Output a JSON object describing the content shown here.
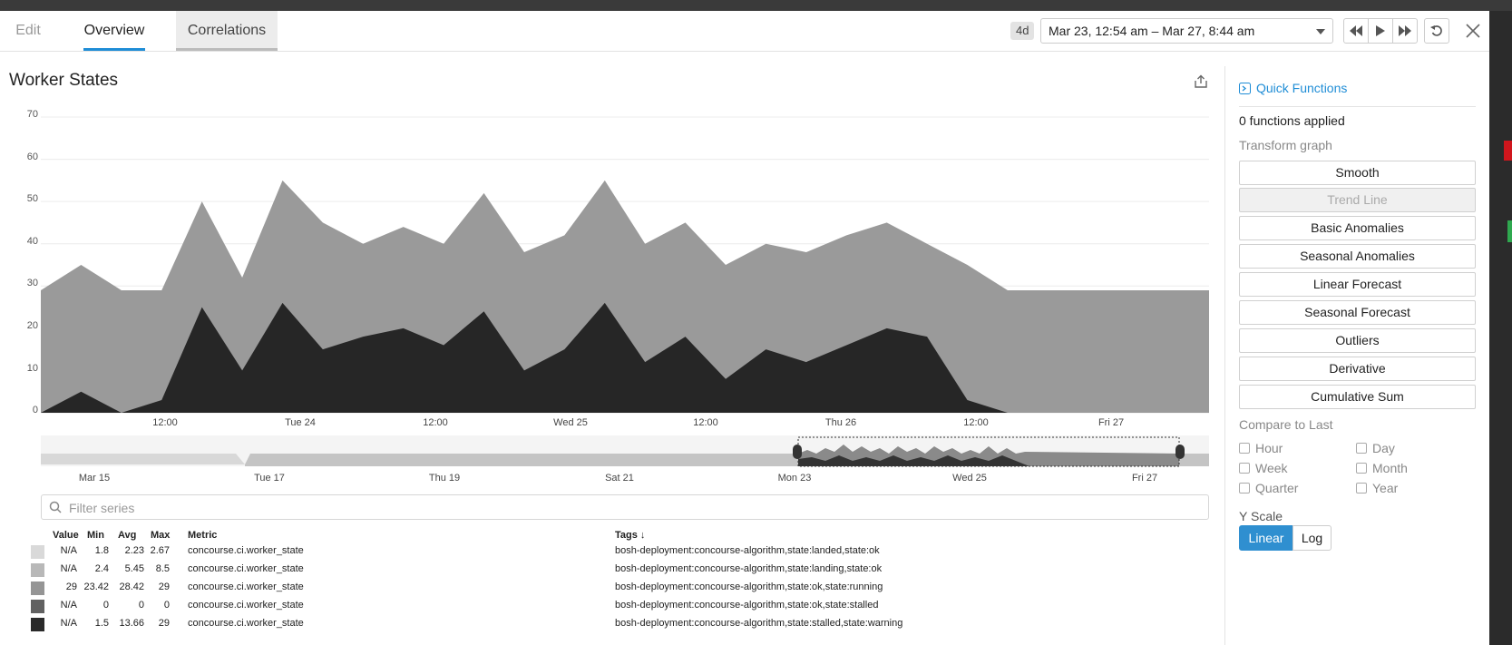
{
  "tabs": [
    {
      "label": "Edit"
    },
    {
      "label": "Overview"
    },
    {
      "label": "Correlations"
    }
  ],
  "timebar": {
    "span_badge": "4d",
    "range_label": "Mar 23, 12:54 am – Mar 27, 8:44 am"
  },
  "chart": {
    "title": "Worker States",
    "y_ticks": [
      "70",
      "60",
      "50",
      "40",
      "30",
      "20",
      "10",
      "0"
    ],
    "x_ticks": [
      "12:00",
      "Tue 24",
      "12:00",
      "Wed 25",
      "12:00",
      "Thu 26",
      "12:00",
      "Fri 27"
    ],
    "nav_ticks": [
      "Mar 15",
      "Tue 17",
      "Thu 19",
      "Sat 21",
      "Mon 23",
      "Wed 25",
      "Fri 27"
    ]
  },
  "chart_data": {
    "type": "area",
    "title": "Worker States",
    "xlabel": "",
    "ylabel": "",
    "ylim": [
      0,
      70
    ],
    "x": [
      "Mar 23 00:54",
      "Mar 23 03:00",
      "Mar 23 06:00",
      "Mar 23 09:00",
      "Mar 23 12:00",
      "Mar 23 15:00",
      "Mar 23 18:00",
      "Mar 23 21:00",
      "Mar 24 00:00",
      "Mar 24 03:00",
      "Mar 24 06:00",
      "Mar 24 09:00",
      "Mar 24 12:00",
      "Mar 24 15:00",
      "Mar 24 18:00",
      "Mar 24 21:00",
      "Mar 25 00:00",
      "Mar 25 03:00",
      "Mar 25 06:00",
      "Mar 25 09:00",
      "Mar 25 12:00",
      "Mar 25 15:00",
      "Mar 25 18:00",
      "Mar 25 21:00",
      "Mar 26 00:00",
      "Mar 26 06:00",
      "Mar 26 12:00",
      "Mar 26 18:00",
      "Mar 27 00:00",
      "Mar 27 08:44"
    ],
    "series": [
      {
        "name": "bosh-deployment:concourse-algorithm,state:ok,state:running",
        "values": [
          29,
          35,
          29,
          29,
          50,
          32,
          55,
          45,
          40,
          44,
          40,
          52,
          38,
          42,
          55,
          40,
          45,
          35,
          40,
          38,
          42,
          45,
          40,
          35,
          29,
          29,
          29,
          29,
          29,
          29
        ]
      },
      {
        "name": "bosh-deployment:concourse-algorithm,state:stalled,state:warning",
        "values": [
          0,
          5,
          0,
          3,
          25,
          10,
          26,
          15,
          18,
          20,
          16,
          24,
          10,
          15,
          26,
          12,
          18,
          8,
          15,
          12,
          16,
          20,
          18,
          3,
          0,
          0,
          0,
          0,
          0,
          0
        ]
      }
    ]
  },
  "filter": {
    "placeholder": "Filter series"
  },
  "legend": {
    "headers": {
      "value": "Value",
      "min": "Min",
      "avg": "Avg",
      "max": "Max",
      "metric": "Metric",
      "tags": "Tags ↓"
    },
    "rows": [
      {
        "color": "#d9d9d9",
        "value": "N/A",
        "min": "1.8",
        "avg": "2.23",
        "max": "2.67",
        "metric": "concourse.ci.worker_state",
        "tags": "bosh-deployment:concourse-algorithm,state:landed,state:ok"
      },
      {
        "color": "#b8b8b8",
        "value": "N/A",
        "min": "2.4",
        "avg": "5.45",
        "max": "8.5",
        "metric": "concourse.ci.worker_state",
        "tags": "bosh-deployment:concourse-algorithm,state:landing,state:ok"
      },
      {
        "color": "#959595",
        "value": "29",
        "min": "23.42",
        "avg": "28.42",
        "max": "29",
        "metric": "concourse.ci.worker_state",
        "tags": "bosh-deployment:concourse-algorithm,state:ok,state:running"
      },
      {
        "color": "#616161",
        "value": "N/A",
        "min": "0",
        "avg": "0",
        "max": "0",
        "metric": "concourse.ci.worker_state",
        "tags": "bosh-deployment:concourse-algorithm,state:ok,state:stalled"
      },
      {
        "color": "#2a2a2a",
        "value": "N/A",
        "min": "1.5",
        "avg": "13.66",
        "max": "29",
        "metric": "concourse.ci.worker_state",
        "tags": "bosh-deployment:concourse-algorithm,state:stalled,state:warning"
      }
    ]
  },
  "panel": {
    "quick_functions": "Quick Functions",
    "applied": "0 functions applied",
    "transform_label": "Transform graph",
    "functions": [
      {
        "label": "Smooth"
      },
      {
        "label": "Trend Line"
      },
      {
        "label": "Basic Anomalies"
      },
      {
        "label": "Seasonal Anomalies"
      },
      {
        "label": "Linear Forecast"
      },
      {
        "label": "Seasonal Forecast"
      },
      {
        "label": "Outliers"
      },
      {
        "label": "Derivative"
      },
      {
        "label": "Cumulative Sum"
      }
    ],
    "compare_label": "Compare to Last",
    "compare": [
      {
        "label": "Hour"
      },
      {
        "label": "Day"
      },
      {
        "label": "Week"
      },
      {
        "label": "Month"
      },
      {
        "label": "Quarter"
      },
      {
        "label": "Year"
      }
    ],
    "yscale_label": "Y Scale",
    "yscale_linear": "Linear",
    "yscale_log": "Log"
  }
}
